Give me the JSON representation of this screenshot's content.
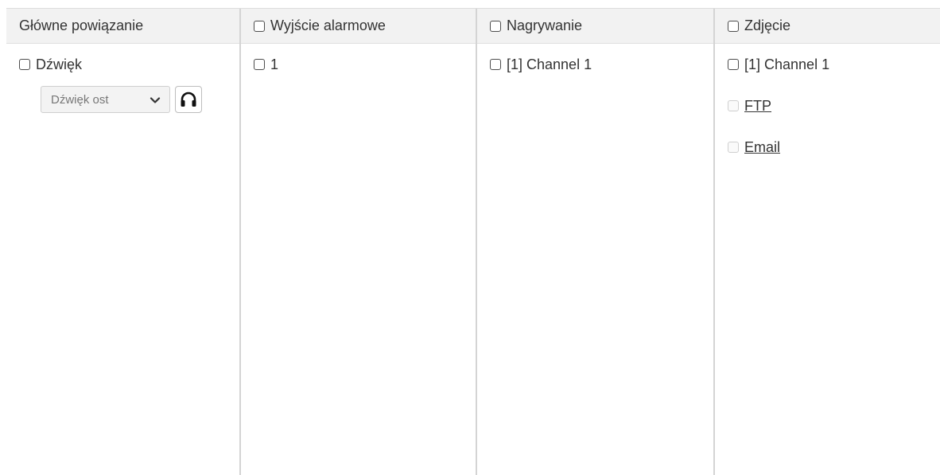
{
  "columns": {
    "main_link": {
      "header": "Główne powiązanie",
      "sound": {
        "label": "Dźwięk",
        "select_value": "Dźwięk ost",
        "listen_icon": "headphones-icon"
      }
    },
    "alarm_output": {
      "header": "Wyjście alarmowe",
      "items": [
        {
          "label": "1"
        }
      ]
    },
    "recording": {
      "header": "Nagrywanie",
      "items": [
        {
          "label": "[1] Channel 1"
        }
      ]
    },
    "snapshot": {
      "header": "Zdjęcie",
      "items": [
        {
          "label": "[1] Channel 1"
        }
      ],
      "links": [
        {
          "label": "FTP"
        },
        {
          "label": "Email"
        }
      ]
    }
  },
  "colors": {
    "header_bg": "#f2f2f2",
    "divider": "#d4d4d4",
    "text": "#333333"
  }
}
